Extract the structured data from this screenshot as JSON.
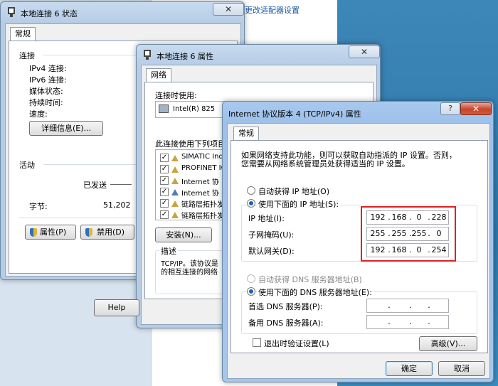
{
  "background": {
    "link_text": "更改适配器设置"
  },
  "status_window": {
    "title": "本地连接 6 状态",
    "close": "✕",
    "tab": "常规",
    "connection_label": "连接",
    "ipv4_label": "IPv4 连接:",
    "ipv6_label": "IPv6 连接:",
    "media_label": "媒体状态:",
    "duration_label": "持续时间:",
    "speed_label": "速度:",
    "details_button": "详细信息(E)...",
    "activity_label": "活动",
    "sent_label": "已发送",
    "bytes_label": "字节:",
    "bytes_value": "51,202",
    "properties_button": "属性(P)",
    "disable_button": "禁用(D)"
  },
  "properties_window": {
    "title": "本地连接 6 属性",
    "close": "✕",
    "tab": "网络",
    "connect_using_label": "连接时使用:",
    "adapter_name": "Intel(R) 825",
    "items_label": "此连接使用下列项目",
    "items": [
      {
        "label": "SIMATIC Ind",
        "checked": true
      },
      {
        "label": "PROFINET IO",
        "checked": true
      },
      {
        "label": "Internet 协",
        "checked": true
      },
      {
        "label": "Internet 协",
        "checked": true
      },
      {
        "label": "链路层拓扑发",
        "checked": true
      },
      {
        "label": "链路层拓扑发",
        "checked": true
      }
    ],
    "install_button": "安装(N)...",
    "description_label": "描述",
    "description_text_1": "TCP/IP。该协议是",
    "description_text_2": "的相互连接的网络",
    "help_button": "Help"
  },
  "tcpip_window": {
    "title": "Internet 协议版本 4 (TCP/IPv4) 属性",
    "help": "?",
    "close": "✕",
    "tab": "常规",
    "intro_line1": "如果网络支持此功能，则可以获取自动指派的 IP 设置。否则，",
    "intro_line2": "您需要从网络系统管理员处获得适当的 IP 设置。",
    "auto_ip_label": "自动获得 IP 地址(O)",
    "manual_ip_label": "使用下面的 IP 地址(S):",
    "ip_label": "IP 地址(I):",
    "ip_value": [
      "192",
      "168",
      "0",
      "228"
    ],
    "mask_label": "子网掩码(U):",
    "mask_value": [
      "255",
      "255",
      "255",
      "0"
    ],
    "gateway_label": "默认网关(D):",
    "gateway_value": [
      "192",
      "168",
      "0",
      "254"
    ],
    "auto_dns_label": "自动获得 DNS 服务器地址(B)",
    "manual_dns_label": "使用下面的 DNS 服务器地址(E):",
    "preferred_dns_label": "首选 DNS 服务器(P):",
    "alternate_dns_label": "备用 DNS 服务器(A):",
    "validate_label": "退出时验证设置(L)",
    "advanced_button": "高级(V)...",
    "ok_button": "确定",
    "cancel_button": "取消"
  },
  "colors": {
    "highlight_box": "#e02020",
    "accent": "#1f5fa8"
  }
}
